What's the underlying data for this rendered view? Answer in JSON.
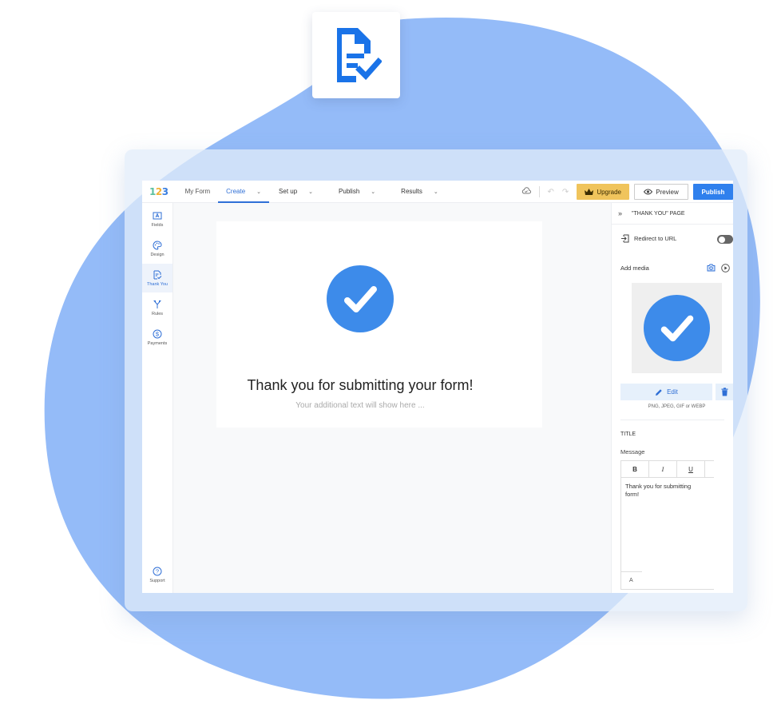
{
  "hero": {
    "icon": "form-check-icon",
    "accent": "#1a73e8"
  },
  "colors": {
    "blob": "#94bbf8",
    "primary": "#2f80ed",
    "upgrade": "#f0c45c",
    "check_circle": "#3d8bea"
  },
  "topbar": {
    "logo": {
      "d1": "1",
      "d2": "2",
      "d3": "3"
    },
    "form_name": "My Form",
    "tabs": [
      {
        "label": "Create",
        "active": true
      },
      {
        "label": "Set up",
        "active": false
      },
      {
        "label": "Publish",
        "active": false
      },
      {
        "label": "Results",
        "active": false
      }
    ],
    "icons": {
      "cloud": "cloud-save-icon",
      "undo": "undo-icon",
      "redo": "redo-icon"
    },
    "upgrade_label": "Upgrade",
    "preview_label": "Preview",
    "publish_label": "Publish"
  },
  "sidebar": {
    "items": [
      {
        "label": "Fields",
        "icon": "fields-icon",
        "active": false
      },
      {
        "label": "Design",
        "icon": "palette-icon",
        "active": false
      },
      {
        "label": "Thank You",
        "icon": "thank-you-icon",
        "active": true
      },
      {
        "label": "Rules",
        "icon": "rules-icon",
        "active": false
      },
      {
        "label": "Payments",
        "icon": "dollar-icon",
        "active": false
      }
    ],
    "support_label": "Support"
  },
  "canvas": {
    "title": "Thank you for submitting your form!",
    "subtitle": "Your additional text will show here ..."
  },
  "panel": {
    "title": "\"THANK YOU\" PAGE",
    "redirect_label": "Redirect to URL",
    "redirect_enabled": false,
    "add_media_label": "Add media",
    "edit_label": "Edit",
    "formats_hint": "PNG, JPEG, GIF or WEBP",
    "title_section": "TITLE",
    "message_label": "Message",
    "editor_tools": [
      "B",
      "I",
      "U"
    ],
    "message_text": "Thank you for submitting form!",
    "footer_tool": "A"
  }
}
